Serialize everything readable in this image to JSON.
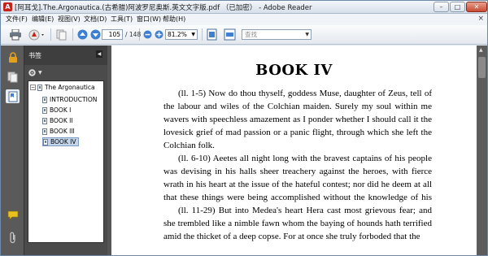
{
  "window": {
    "title": "[阿耳戈].The.Argonautica.(古希腊)阿波罗尼奥斯.英文文字版.pdf （已加密） - Adobe Reader",
    "app_icon_label": "A",
    "minimize": "–",
    "restore": "□",
    "close": "✕"
  },
  "menu": {
    "items": [
      "文件(F)",
      "编辑(E)",
      "视图(V)",
      "文档(D)",
      "工具(T)",
      "窗口(W)",
      "帮助(H)"
    ],
    "close_doc": "×"
  },
  "toolbar": {
    "page_current": "105",
    "page_total": "/ 148",
    "zoom": "81.2%",
    "find_placeholder": "查找"
  },
  "bookmarks_panel": {
    "title": "书签",
    "root": "The Argonautica",
    "items": [
      "INTRODUCTION",
      "BOOK I",
      "BOOK II",
      "BOOK III",
      "BOOK IV"
    ],
    "selected": "BOOK IV"
  },
  "document": {
    "heading": "BOOK IV",
    "paragraphs": [
      "(ll. 1-5)   Now do thou thyself, goddess Muse, daughter of Zeus, tell of the labour and wiles of the Colchian maiden.   Surely my soul within me wavers with speechless amazement as I ponder whether I should call it the lovesick grief of mad passion or a panic flight, through which she left the Colchian folk.",
      "(ll. 6-10)   Aeetes all night long with the bravest captains of his people was devising in his halls sheer treachery against the heroes, with fierce wrath in his heart at the issue of the hateful contest; nor did he deem at all that these things were being accomplished without the knowledge of his daughters.",
      "(ll. 11-29)   But into Medea's heart Hera cast most grievous fear; and she trembled like a nimble fawn whom the baying of hounds hath terrified amid the thicket of a deep copse.   For at once she truly forboded that the"
    ]
  }
}
